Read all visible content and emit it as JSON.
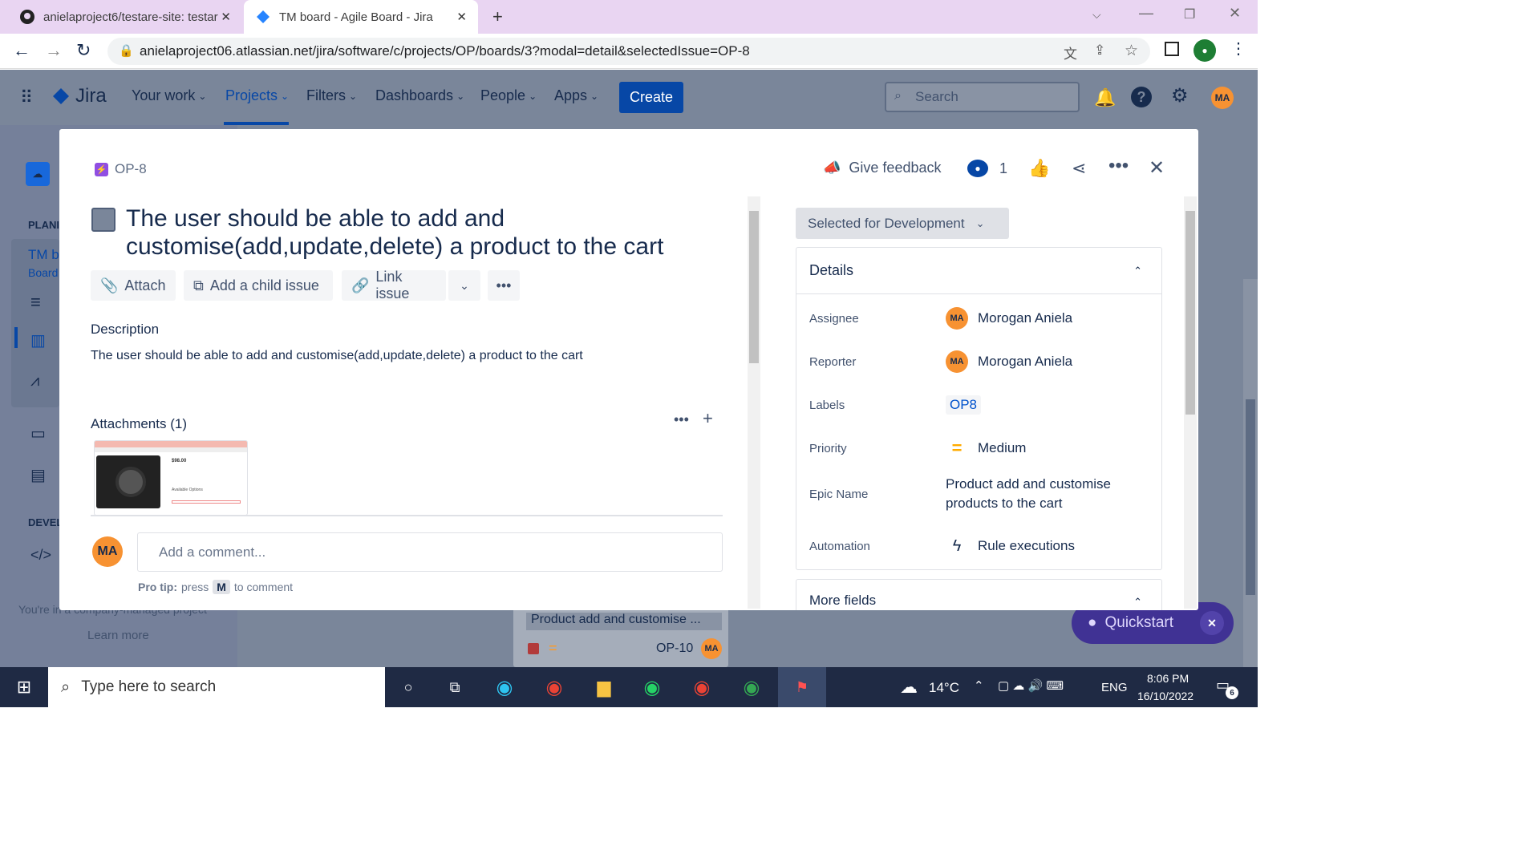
{
  "browser": {
    "tabs": [
      {
        "title": "anielaproject6/testare-site: testar"
      },
      {
        "title": "TM board - Agile Board - Jira"
      }
    ],
    "url": "anielaproject06.atlassian.net/jira/software/c/projects/OP/boards/3?modal=detail&selectedIssue=OP-8"
  },
  "nav": {
    "brand": "Jira",
    "items": [
      "Your work",
      "Projects",
      "Filters",
      "Dashboards",
      "People",
      "Apps"
    ],
    "create": "Create",
    "search_placeholder": "Search",
    "user_initials": "MA"
  },
  "sidebar": {
    "planning": "PLANI",
    "project_name": "TM b",
    "project_sub": "Board",
    "development": "DEVEL",
    "footer": "You're in a company-managed project",
    "learn_more": "Learn more"
  },
  "background_card": {
    "epic": "Product add and customise ...",
    "key": "OP-10",
    "initials": "MA"
  },
  "issue": {
    "key": "OP-8",
    "title": "The user should be able to add and customise(add,update,delete) a product to the cart",
    "give_feedback": "Give feedback",
    "watchers": "1",
    "actions": {
      "attach": "Attach",
      "child": "Add a child issue",
      "link": "Link issue"
    },
    "description_heading": "Description",
    "description": "The user should be able to add and customise(add,update,delete) a product to the cart",
    "attachments_heading": "Attachments (1)",
    "thumb_price": "$98.00",
    "thumb_options": "Available Options",
    "comment_placeholder": "Add a comment...",
    "comment_initials": "MA",
    "protip_label": "Pro tip:",
    "protip_press": "press",
    "protip_key": "M",
    "protip_rest": "to comment"
  },
  "details": {
    "status": "Selected for Development",
    "heading": "Details",
    "assignee_label": "Assignee",
    "assignee": "Morogan Aniela",
    "reporter_label": "Reporter",
    "reporter": "Morogan Aniela",
    "labels_label": "Labels",
    "label_value": "OP8",
    "priority_label": "Priority",
    "priority": "Medium",
    "epic_label": "Epic Name",
    "epic": "Product add and customise products to the cart",
    "automation_label": "Automation",
    "automation": "Rule executions",
    "more_fields": "More fields",
    "initials": "MA"
  },
  "quickstart": "Quickstart",
  "taskbar": {
    "search": "Type here to search",
    "temp": "14°C",
    "lang": "ENG",
    "time": "8:06 PM",
    "date": "16/10/2022",
    "notif": "6"
  },
  "colors": {
    "accent": "#0747a6",
    "avatar": "#f79232",
    "issue_icon": "#904ee2"
  }
}
